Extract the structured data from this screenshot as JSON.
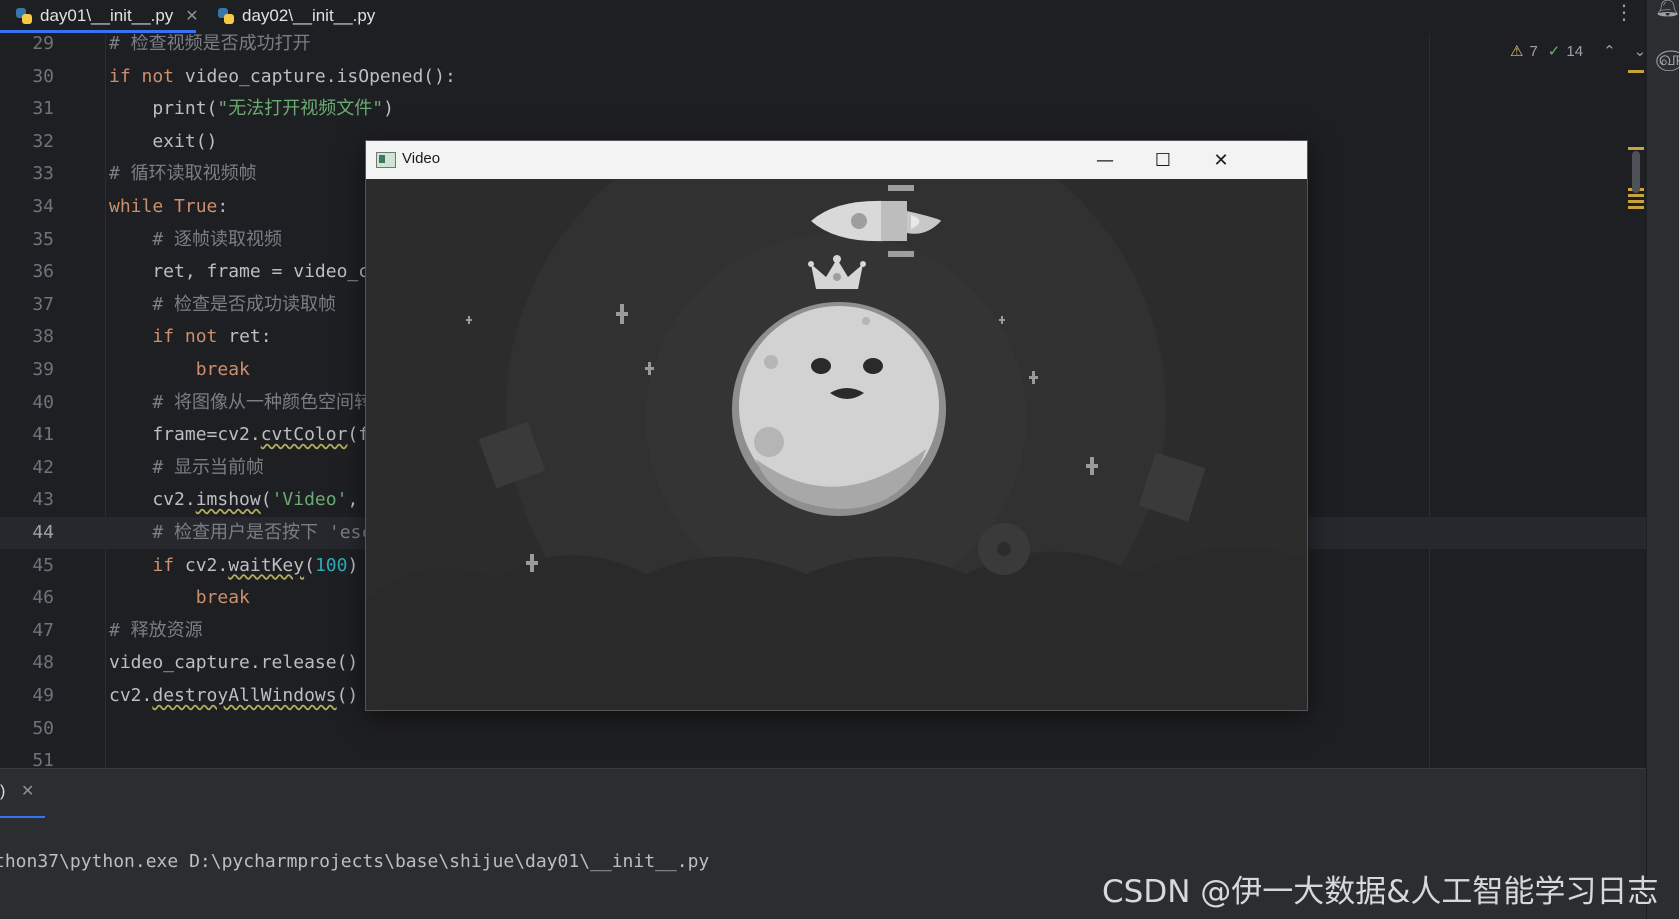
{
  "tabs": [
    {
      "label": "day01\\__init__.py",
      "active": true
    },
    {
      "label": "day02\\__init__.py",
      "active": false
    }
  ],
  "inspections": {
    "warnings": "7",
    "passed": "14"
  },
  "code_lines": [
    {
      "n": "29",
      "html": "<span class='cmt'># 检查视频是否成功打开</span>"
    },
    {
      "n": "30",
      "html": "<span class='kw'>if not</span> video_capture.isOpened():"
    },
    {
      "n": "31",
      "html": "    <span class='fn'>print</span>(<span class='str'>\"无法打开视频文件\"</span>)"
    },
    {
      "n": "32",
      "html": "    exit()"
    },
    {
      "n": "33",
      "html": "<span class='cmt'># 循环读取视频帧</span>"
    },
    {
      "n": "34",
      "html": "<span class='kw'>while True</span>:"
    },
    {
      "n": "35",
      "html": "    <span class='cmt'># 逐帧读取视频</span>"
    },
    {
      "n": "36",
      "html": "    ret, frame = video_c"
    },
    {
      "n": "37",
      "html": "    <span class='cmt'># 检查是否成功读取帧</span>"
    },
    {
      "n": "38",
      "html": "    <span class='kw'>if not</span> ret:"
    },
    {
      "n": "39",
      "html": "        <span class='kw'>break</span>"
    },
    {
      "n": "40",
      "html": "    <span class='cmt'># 将图像从一种颜色空间转</span>"
    },
    {
      "n": "41",
      "html": "    frame=cv2.<span class='wavy'>cvtColor</span>(f"
    },
    {
      "n": "42",
      "html": "    <span class='cmt'># 显示当前帧</span>"
    },
    {
      "n": "43",
      "html": "    cv2.<span class='wavy'>imshow</span>(<span class='str'>'Video'</span>,"
    },
    {
      "n": "44",
      "html": "    <span class='cmt'># 检查用户是否按下 'esc</span>",
      "current": true
    },
    {
      "n": "45",
      "html": "    <span class='kw'>if</span> cv2.<span class='wavy'>waitKey</span>(<span class='num'>100</span>)"
    },
    {
      "n": "46",
      "html": "        <span class='kw'>break</span>"
    },
    {
      "n": "47",
      "html": "<span class='cmt'># 释放资源</span>"
    },
    {
      "n": "48",
      "html": "video_capture.release()"
    },
    {
      "n": "49",
      "html": "cv2.<span class='wavy'>destroyAllWindows</span>()"
    },
    {
      "n": "50",
      "html": ""
    },
    {
      "n": "51",
      "html": ""
    }
  ],
  "video_window": {
    "title": "Video",
    "minimize": "—",
    "maximize": "☐",
    "close": "✕"
  },
  "bottom_panel": {
    "tab_label": ")",
    "close": "✕"
  },
  "console": {
    "text": "thon37\\python.exe D:\\pycharmprojects\\base\\shijue\\day01\\__init__.py"
  },
  "watermark": "CSDN @伊一大数据&人工智能学习日志",
  "icons": {
    "menu": "more-vertical-icon",
    "bell": "bell-icon",
    "ai": "ai-spiral-icon"
  }
}
